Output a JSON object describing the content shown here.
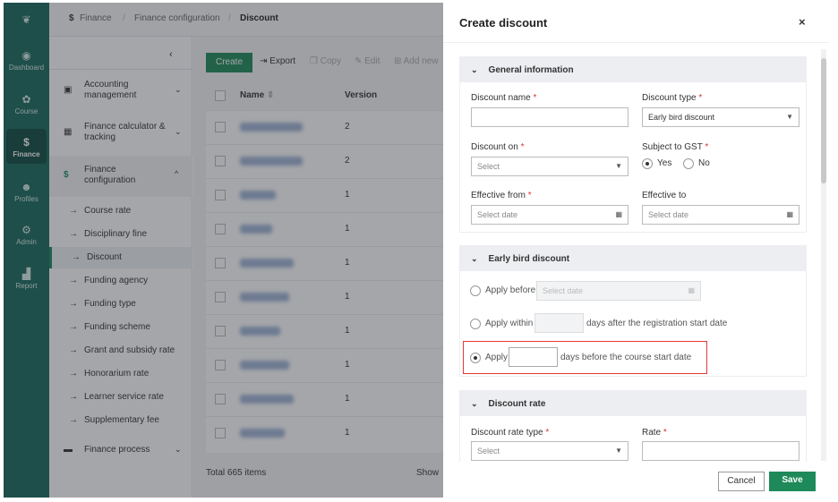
{
  "rail": {
    "items": [
      {
        "label": "Dashboard",
        "icon": "compass-icon"
      },
      {
        "label": "Course",
        "icon": "course-icon"
      },
      {
        "label": "Finance",
        "icon": "dollar-icon"
      },
      {
        "label": "Profiles",
        "icon": "users-icon"
      },
      {
        "label": "Admin",
        "icon": "admin-icon"
      },
      {
        "label": "Report",
        "icon": "chart-icon"
      }
    ]
  },
  "breadcrumb": [
    "Finance",
    "Finance configuration",
    "Discount"
  ],
  "sidebar": {
    "groups": [
      {
        "label": "Accounting management",
        "icon": "calendar-icon"
      },
      {
        "label": "Finance calculator & tracking",
        "icon": "calculator-icon"
      },
      {
        "label": "Finance configuration",
        "icon": "dollar-icon"
      }
    ],
    "items": [
      "Course rate",
      "Disciplinary fine",
      "Discount",
      "Funding agency",
      "Funding type",
      "Funding scheme",
      "Grant and subsidy rate",
      "Honorarium rate",
      "Learner service rate",
      "Supplementary fee"
    ],
    "active": "Discount",
    "last_group": "Finance process"
  },
  "toolbar": {
    "create": "Create",
    "export": "Export",
    "copy": "Copy",
    "edit": "Edit",
    "add_new": "Add new"
  },
  "table": {
    "columns": [
      "Name",
      "Version"
    ],
    "versions": [
      "2",
      "2",
      "1",
      "1",
      "1",
      "1",
      "1",
      "1",
      "1",
      "1"
    ]
  },
  "footer": {
    "total": "Total 665 items",
    "show": "Show"
  },
  "panel": {
    "title": "Create discount",
    "general": {
      "title": "General information",
      "discount_name": "Discount name",
      "discount_type": "Discount type",
      "discount_type_value": "Early bird discount",
      "discount_on": "Discount on",
      "select": "Select",
      "gst": "Subject to GST",
      "yes": "Yes",
      "no": "No",
      "gst_value": "Yes",
      "effective_from": "Effective from",
      "effective_to": "Effective to",
      "select_date": "Select date"
    },
    "early": {
      "title": "Early bird discount",
      "apply_before": "Apply before",
      "apply_within": "Apply within",
      "after_reg": "days after the registration start date",
      "apply": "Apply",
      "before_course": "days before the course start date",
      "selected": "Apply days before the course start date"
    },
    "rate": {
      "title": "Discount rate",
      "type": "Discount rate type",
      "rate": "Rate",
      "select": "Select"
    },
    "cancel": "Cancel",
    "save": "Save"
  },
  "colors": {
    "primary": "#1e8a5a",
    "rail": "#17695c",
    "highlight": "#e53935"
  }
}
